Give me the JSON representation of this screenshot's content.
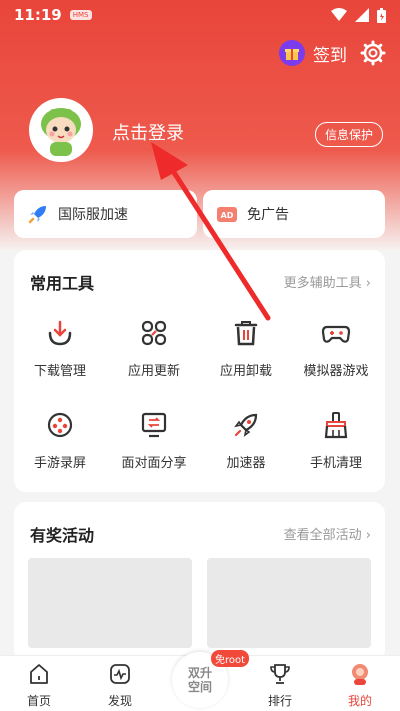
{
  "status": {
    "time": "11:19",
    "badge": "HMS"
  },
  "header": {
    "signin_label": "签到",
    "login_label": "点击登录",
    "privacy_label": "信息保护"
  },
  "quick": [
    {
      "label": "国际服加速",
      "icon": "rocket-icon"
    },
    {
      "label": "免广告",
      "icon": "ad-icon"
    }
  ],
  "tools": {
    "title": "常用工具",
    "more": "更多辅助工具",
    "items": [
      {
        "label": "下载管理",
        "icon": "download-icon"
      },
      {
        "label": "应用更新",
        "icon": "apps-icon"
      },
      {
        "label": "应用卸载",
        "icon": "trash-icon"
      },
      {
        "label": "模拟器游戏",
        "icon": "gamepad-icon"
      },
      {
        "label": "手游录屏",
        "icon": "record-icon"
      },
      {
        "label": "面对面分享",
        "icon": "share-screen-icon"
      },
      {
        "label": "加速器",
        "icon": "rocket-icon"
      },
      {
        "label": "手机清理",
        "icon": "broom-icon"
      }
    ]
  },
  "activities": {
    "title": "有奖活动",
    "more": "查看全部活动"
  },
  "tabbar": {
    "items": [
      {
        "label": "首页",
        "icon": "home-icon"
      },
      {
        "label": "发现",
        "icon": "discover-icon"
      },
      {
        "label": "排行",
        "icon": "trophy-icon"
      },
      {
        "label": "我的",
        "icon": "profile-icon"
      }
    ],
    "center_line1": "双升",
    "center_line2": "空间",
    "center_badge": "免root"
  },
  "colors": {
    "accent": "#e9453a",
    "purple": "#7b3cf0"
  }
}
